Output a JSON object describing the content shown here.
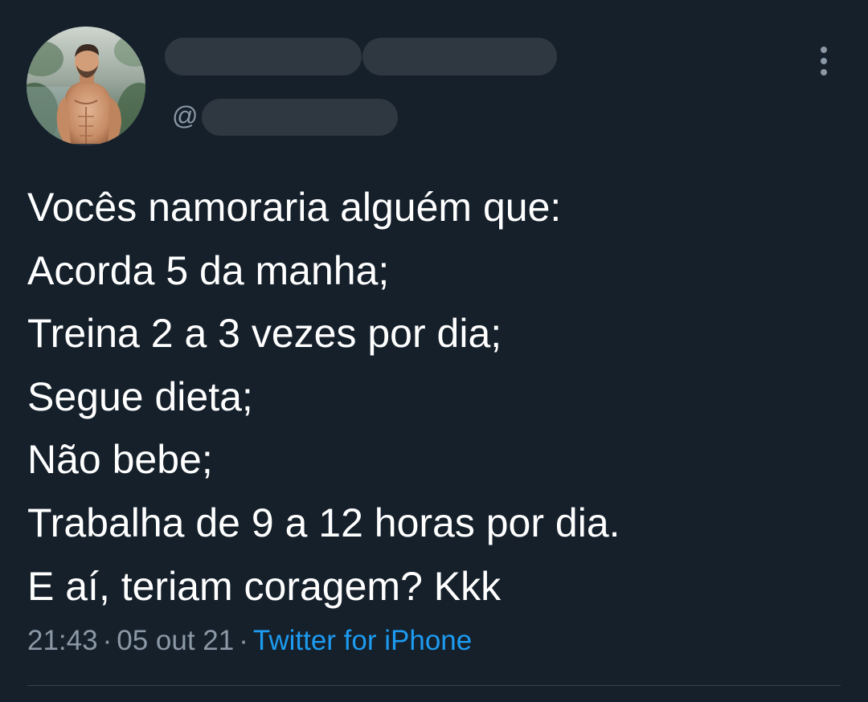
{
  "tweet": {
    "author": {
      "handle_prefix": "@",
      "avatar_icon": "profile-photo"
    },
    "text_lines": [
      "Vocês namoraria alguém que:",
      "Acorda 5 da manha;",
      "Treina 2 a 3 vezes por dia;",
      "Segue dieta;",
      "Não bebe;",
      "Trabalha de 9 a 12 horas por dia.",
      "E aí, teriam coragem? Kkk"
    ],
    "meta": {
      "time": "21:43",
      "separator": "·",
      "date": "05 out 21",
      "source": "Twitter for iPhone"
    },
    "more_icon": "more-vertical-icon"
  },
  "colors": {
    "background": "#15202b",
    "text": "#ffffff",
    "secondary_text": "#8b98a5",
    "link": "#1d9bf0",
    "redaction": "#2f3841",
    "divider": "#38444d"
  }
}
